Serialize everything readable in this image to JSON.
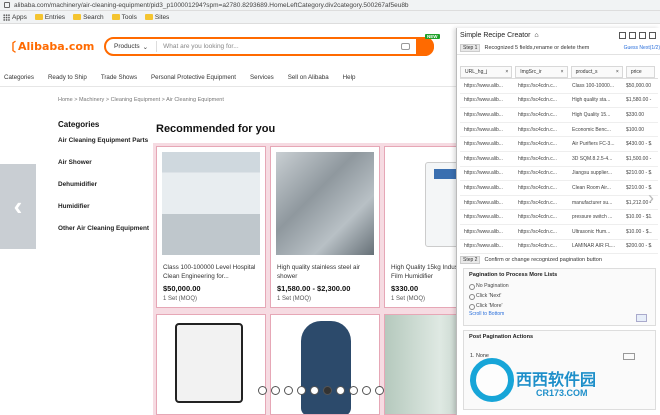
{
  "browser": {
    "url": "alibaba.com/machinery/air-cleaning-equipment/pid3_p100001294?spm=a2780.8293689.HomeLeftCategory.div2category.500267af5eu8b",
    "bookmarks": [
      "Apps",
      "Entries",
      "Search",
      "Tools",
      "Sites"
    ]
  },
  "header": {
    "logo": "Alibaba.com",
    "search_category": "Products",
    "search_placeholder": "What are you looking for...",
    "new_badge": "NEW"
  },
  "nav": [
    "Categories",
    "Ready to Ship",
    "Trade Shows",
    "Personal Protective Equipment",
    "Services",
    "Sell on Alibaba",
    "Help"
  ],
  "breadcrumb": "Home > Machinery > Cleaning Equipment > Air Cleaning Equipment",
  "categories": {
    "title": "Categories",
    "items": [
      "Air Cleaning Equipment Parts",
      "Air Shower",
      "Dehumidifier",
      "Humidifier",
      "Other Air Cleaning Equipment"
    ]
  },
  "recommended": {
    "title": "Recommended for you",
    "products": [
      {
        "name": "Class 100-100000 Level Hospital Clean Engineering for...",
        "price": "$50,000.00",
        "moq": "1 Set (MOQ)"
      },
      {
        "name": "High quality stainless steel air shower",
        "price": "$1,580.00 - $2,300.00",
        "moq": "1 Set (MOQ)"
      },
      {
        "name": "High Quality 15kg Industrial Wet Film Humidifier",
        "price": "$330.00",
        "moq": "1 Set (MOQ)"
      }
    ]
  },
  "extension": {
    "title": "Simple Recipe Creator",
    "step1_no": "Step 1",
    "step1_text": "Recognized 5 fields,rename or delete them",
    "step1_next": "Guess Next(1/2)",
    "columns": [
      "URL_hg_j",
      "ImgSrc_ir",
      "product_s",
      "price"
    ],
    "rows": [
      [
        "https://www.alib...",
        "https://sc4cdn.c...",
        "Class 100-10000...",
        "$50,000.00"
      ],
      [
        "https://www.alib...",
        "https://sc4cdn.c...",
        "High quality sta...",
        "$1,580.00 - $..."
      ],
      [
        "https://www.alib...",
        "https://sc4cdn.c...",
        "High Quality 15...",
        "$330.00"
      ],
      [
        "https://www.alib...",
        "https://sc4cdn.c...",
        "Economic Benc...",
        "$100.00"
      ],
      [
        "https://www.alib...",
        "https://sc4cdn.c...",
        "Air Purifiers FC-3...",
        "$430.00 - $..."
      ],
      [
        "https://www.alib...",
        "https://sc4cdn.c...",
        "3D SQM.8.2.5-4...",
        "$1,500.00 - ..."
      ],
      [
        "https://www.alib...",
        "https://sc4cdn.c...",
        "Jiangsu supplier...",
        "$210.00 - $..."
      ],
      [
        "https://www.alib...",
        "https://sc4cdn.c...",
        "Clean Room Air...",
        "$210.00 - $..."
      ],
      [
        "https://www.alib...",
        "https://sc4cdn.c...",
        "manufacturer su...",
        "$1,212.00 - ..."
      ],
      [
        "https://www.alib...",
        "https://sc4cdn.c...",
        "pressure switch ...",
        "$10.00 - $1..."
      ],
      [
        "https://www.alib...",
        "https://sc4cdn.c...",
        "Ultrasonic Hum...",
        "$10.00 - $..."
      ],
      [
        "https://www.alib...",
        "https://sc4cdn.c...",
        "LAMINAR AIR FL...",
        "$200.00 - $..."
      ]
    ],
    "step2_no": "Step 2",
    "step2_text": "Confirm or change recognized pagination button",
    "pagination_title": "Pagination to Process More Lists",
    "pagination_options": [
      "No Pagination",
      "Click 'Next'",
      "Click 'More'"
    ],
    "scroll_bottom": "Scroll to Bottom",
    "post_title": "Post Pagination Actions",
    "post_item": "1. None"
  },
  "watermark": {
    "text": "西西软件园",
    "url": "CR173.COM"
  }
}
